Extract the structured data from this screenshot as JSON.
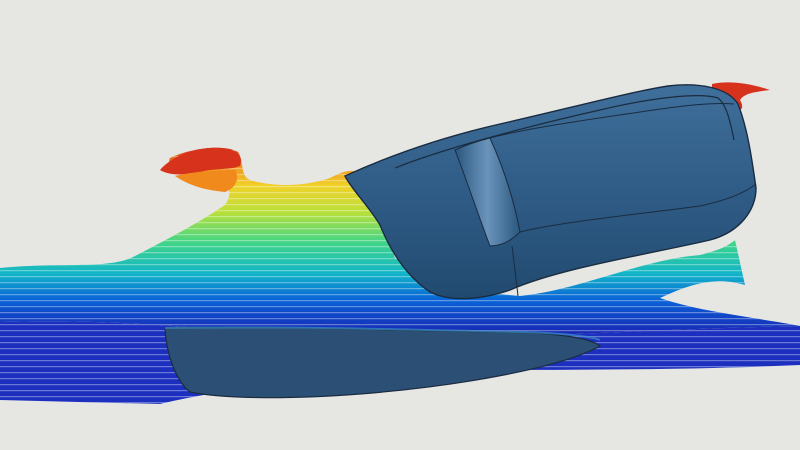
{
  "scene": {
    "kind": "cfd-simulation-render",
    "background": "#e6e6e3",
    "hull_color": "#2f5c86",
    "hull_edge_color": "#1a2c40",
    "wave_colormap": [
      "#1a1fb0",
      "#0a62d6",
      "#12b5c9",
      "#3fd58a",
      "#b8e03a",
      "#f0d22a",
      "#f08a1d",
      "#d6321c"
    ]
  }
}
